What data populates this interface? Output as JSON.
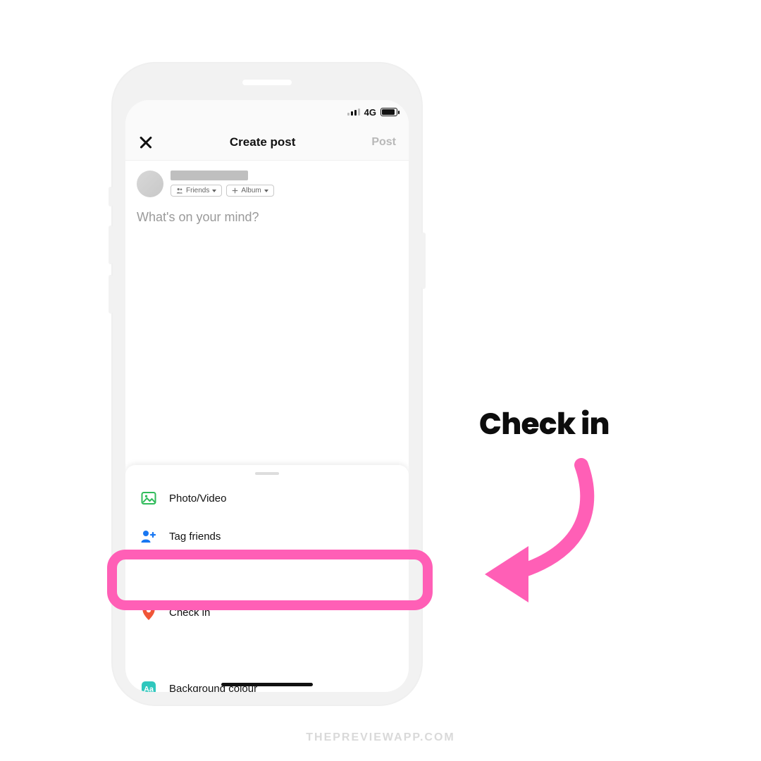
{
  "status": {
    "network_label": "4G"
  },
  "nav": {
    "title": "Create post",
    "post_label": "Post"
  },
  "pills": {
    "friends": "Friends",
    "album": "Album"
  },
  "composer": {
    "placeholder": "What's on your mind?"
  },
  "sheet": {
    "items": [
      {
        "label": "Photo/Video"
      },
      {
        "label": "Tag friends"
      },
      {
        "label": ""
      },
      {
        "label": "Check in"
      },
      {
        "label": ""
      },
      {
        "label": "Background colour"
      }
    ]
  },
  "annotation": {
    "label": "Check in"
  },
  "watermark": "THEPREVIEWAPP.COM"
}
